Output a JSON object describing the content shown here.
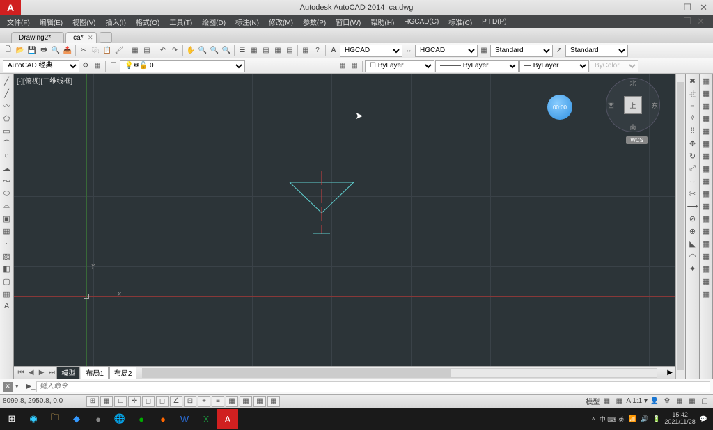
{
  "title": {
    "app": "Autodesk AutoCAD 2014",
    "file": "ca.dwg",
    "app_letter": "A"
  },
  "window_controls": {
    "min": "—",
    "max": "☐",
    "close": "✕"
  },
  "menus": [
    "文件(F)",
    "编辑(E)",
    "视图(V)",
    "插入(I)",
    "格式(O)",
    "工具(T)",
    "绘图(D)",
    "标注(N)",
    "修改(M)",
    "参数(P)",
    "窗口(W)",
    "帮助(H)",
    "HGCAD(C)",
    "标准(C)",
    "P I D(P)"
  ],
  "tabs": {
    "items": [
      {
        "label": "Drawing2*",
        "active": false
      },
      {
        "label": "ca*",
        "active": true
      }
    ]
  },
  "toolbar1": {
    "style_selects": [
      {
        "value": "HGCAD"
      },
      {
        "value": "HGCAD"
      },
      {
        "value": "Standard"
      },
      {
        "value": "Standard"
      }
    ]
  },
  "toolbar2": {
    "workspace": "AutoCAD 经典",
    "layer_select": "0",
    "bylayer1": "ByLayer",
    "bylayer2": "ByLayer",
    "bylayer3": "ByLayer",
    "bycolor": "ByColor"
  },
  "view": {
    "label": "[-][俯视][二维线框]",
    "ucs_x": "X",
    "ucs_y": "Y",
    "wcs": "WCS",
    "recorder": "00:00",
    "compass": {
      "n": "北",
      "s": "南",
      "e": "东",
      "w": "西",
      "face": "上"
    }
  },
  "layouts": {
    "tabs": [
      "模型",
      "布局1",
      "布局2"
    ]
  },
  "command": {
    "placeholder": "键入命令"
  },
  "status": {
    "coords": [
      "8099.8,",
      "2950.8,",
      "0.0"
    ],
    "right_text": "模型",
    "scale": "A 1:1 ▾",
    "lang": "中 ⌨ 英"
  },
  "taskbar": {
    "time": "15:42",
    "date": "2021/11/28"
  }
}
